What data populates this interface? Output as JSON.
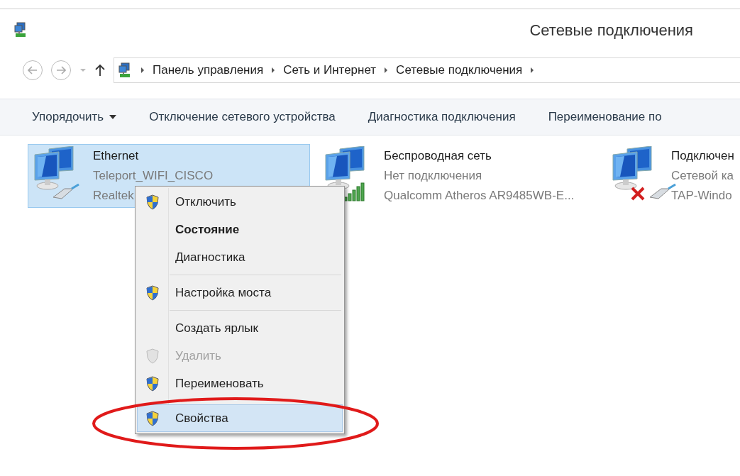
{
  "window": {
    "title": "Сетевые подключения"
  },
  "address": {
    "back_disabled": true,
    "forward_disabled": true,
    "path": [
      "Панель управления",
      "Сеть и Интернет",
      "Сетевые подключения"
    ]
  },
  "toolbar": [
    {
      "label": "Упорядочить",
      "kind": "dropdown"
    },
    {
      "label": "Отключение сетевого устройства",
      "kind": "button"
    },
    {
      "label": "Диагностика подключения",
      "kind": "button"
    },
    {
      "label": "Переименование по",
      "kind": "button"
    }
  ],
  "connections": [
    {
      "name": "Ethernet",
      "status": "Teleport_WIFI_CISCO",
      "adapter": "Realtek",
      "kind": "cable",
      "selected": true
    },
    {
      "name": "Беспроводная сеть",
      "status": "Нет подключения",
      "adapter": "Qualcomm Atheros AR9485WB-E...",
      "kind": "signal",
      "selected": false
    },
    {
      "name": "Подключен",
      "status": "Сетевой ка",
      "adapter": "TAP-Windo",
      "kind": "disconnected",
      "selected": false
    }
  ],
  "context_menu": {
    "groups": [
      [
        {
          "label": "Отключить",
          "shield": true,
          "bold": false,
          "disabled": false,
          "selected": false
        },
        {
          "label": "Состояние",
          "shield": false,
          "bold": true,
          "disabled": false,
          "selected": false
        },
        {
          "label": "Диагностика",
          "shield": false,
          "bold": false,
          "disabled": false,
          "selected": false
        }
      ],
      [
        {
          "label": "Настройка моста",
          "shield": true,
          "bold": false,
          "disabled": false,
          "selected": false
        }
      ],
      [
        {
          "label": "Создать ярлык",
          "shield": false,
          "bold": false,
          "disabled": false,
          "selected": false
        },
        {
          "label": "Удалить",
          "shield": true,
          "bold": false,
          "disabled": true,
          "selected": false
        },
        {
          "label": "Переименовать",
          "shield": true,
          "bold": false,
          "disabled": false,
          "selected": false
        },
        {
          "label": "Свойства",
          "shield": true,
          "bold": false,
          "disabled": false,
          "selected": true
        }
      ]
    ]
  }
}
